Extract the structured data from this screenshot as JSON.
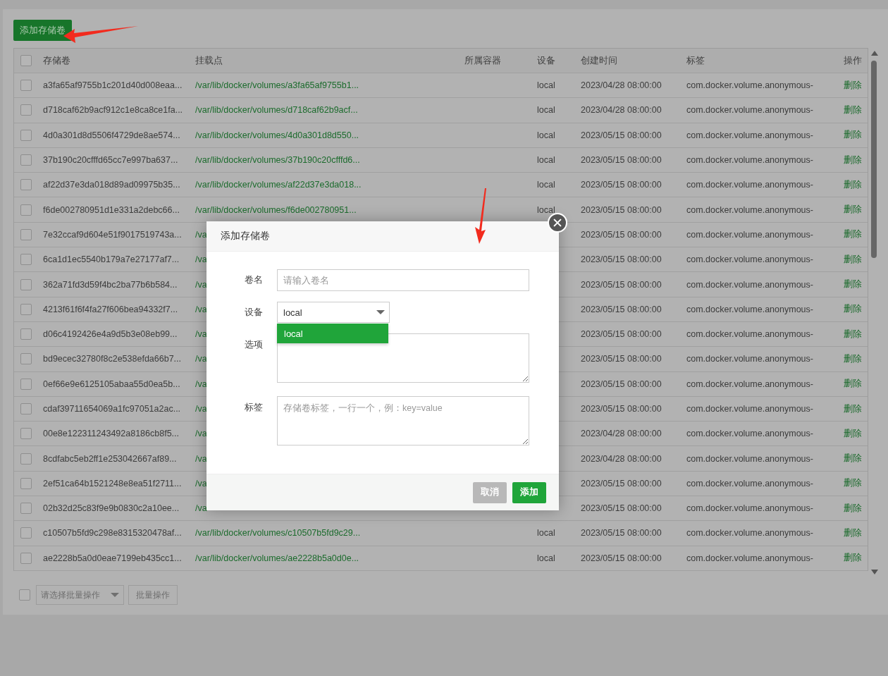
{
  "add_button": {
    "label": "添加存储卷"
  },
  "table": {
    "all_checked": false,
    "columns": [
      "存储卷",
      "挂载点",
      "所属容器",
      "设备",
      "创建时间",
      "标签",
      "操作"
    ],
    "rows": [
      {
        "selected": false,
        "name": "a3fa65af9755b1c201d40d008eaa...",
        "mount": "/var/lib/docker/volumes/a3fa65af9755b1...",
        "device": "local",
        "created": "2023/04/28 08:00:00",
        "label": "com.docker.volume.anonymous-",
        "action": "删除"
      },
      {
        "selected": false,
        "name": "d718caf62b9acf912c1e8ca8ce1fa...",
        "mount": "/var/lib/docker/volumes/d718caf62b9acf...",
        "device": "local",
        "created": "2023/04/28 08:00:00",
        "label": "com.docker.volume.anonymous-",
        "action": "删除"
      },
      {
        "selected": false,
        "name": "4d0a301d8d5506f4729de8ae574...",
        "mount": "/var/lib/docker/volumes/4d0a301d8d550...",
        "device": "local",
        "created": "2023/05/15 08:00:00",
        "label": "com.docker.volume.anonymous-",
        "action": "删除"
      },
      {
        "selected": false,
        "name": "37b190c20cfffd65cc7e997ba637...",
        "mount": "/var/lib/docker/volumes/37b190c20cfffd6...",
        "device": "local",
        "created": "2023/05/15 08:00:00",
        "label": "com.docker.volume.anonymous-",
        "action": "删除"
      },
      {
        "selected": false,
        "name": "af22d37e3da018d89ad09975b35...",
        "mount": "/var/lib/docker/volumes/af22d37e3da018...",
        "device": "local",
        "created": "2023/05/15 08:00:00",
        "label": "com.docker.volume.anonymous-",
        "action": "删除"
      },
      {
        "selected": false,
        "name": "f6de002780951d1e331a2debc66...",
        "mount": "/var/lib/docker/volumes/f6de002780951...",
        "device": "local",
        "created": "2023/05/15 08:00:00",
        "label": "com.docker.volume.anonymous-",
        "action": "删除"
      },
      {
        "selected": false,
        "name": "7e32ccaf9d604e51f9017519743a...",
        "mount": "/va",
        "created": "2023/05/15 08:00:00",
        "label": "com.docker.volume.anonymous-",
        "action": "删除"
      },
      {
        "selected": false,
        "name": "6ca1d1ec5540b179a7e27177af7...",
        "mount": "/va",
        "created": "2023/05/15 08:00:00",
        "label": "com.docker.volume.anonymous-",
        "action": "删除"
      },
      {
        "selected": false,
        "name": "362a71fd3d59f4bc2ba77b6b584...",
        "mount": "/va",
        "created": "2023/05/15 08:00:00",
        "label": "com.docker.volume.anonymous-",
        "action": "删除"
      },
      {
        "selected": false,
        "name": "4213f61f6f4fa27f606bea94332f7...",
        "mount": "/va",
        "created": "2023/05/15 08:00:00",
        "label": "com.docker.volume.anonymous-",
        "action": "删除"
      },
      {
        "selected": false,
        "name": "d06c4192426e4a9d5b3e08eb99...",
        "mount": "/va",
        "created": "2023/05/15 08:00:00",
        "label": "com.docker.volume.anonymous-",
        "action": "删除"
      },
      {
        "selected": false,
        "name": "bd9ecec32780f8c2e538efda66b7...",
        "mount": "/va",
        "created": "2023/05/15 08:00:00",
        "label": "com.docker.volume.anonymous-",
        "action": "删除"
      },
      {
        "selected": false,
        "name": "0ef66e9e6125105abaa55d0ea5b...",
        "mount": "/va",
        "created": "2023/05/15 08:00:00",
        "label": "com.docker.volume.anonymous-",
        "action": "删除"
      },
      {
        "selected": false,
        "name": "cdaf39711654069a1fc97051a2ac...",
        "mount": "/va",
        "created": "2023/05/15 08:00:00",
        "label": "com.docker.volume.anonymous-",
        "action": "删除"
      },
      {
        "selected": false,
        "name": "00e8e122311243492a8186cb8f5...",
        "mount": "/va",
        "created": "2023/04/28 08:00:00",
        "label": "com.docker.volume.anonymous-",
        "action": "删除"
      },
      {
        "selected": false,
        "name": "8cdfabc5eb2ff1e253042667af89...",
        "mount": "/va",
        "created": "2023/04/28 08:00:00",
        "label": "com.docker.volume.anonymous-",
        "action": "删除"
      },
      {
        "selected": false,
        "name": "2ef51ca64b1521248e8ea51f2711...",
        "mount": "/va",
        "created": "2023/05/15 08:00:00",
        "label": "com.docker.volume.anonymous-",
        "action": "删除"
      },
      {
        "selected": false,
        "name": "02b32d25c83f9e9b0830c2a10ee...",
        "mount": "/va",
        "created": "2023/05/15 08:00:00",
        "label": "com.docker.volume.anonymous-",
        "action": "删除"
      },
      {
        "selected": false,
        "name": "c10507b5fd9c298e8315320478af...",
        "mount": "/var/lib/docker/volumes/c10507b5fd9c29...",
        "device": "local",
        "created": "2023/05/15 08:00:00",
        "label": "com.docker.volume.anonymous-",
        "action": "删除"
      },
      {
        "selected": false,
        "name": "ae2228b5a0d0eae7199eb435cc1...",
        "mount": "/var/lib/docker/volumes/ae2228b5a0d0e...",
        "device": "local",
        "created": "2023/05/15 08:00:00",
        "label": "com.docker.volume.anonymous-",
        "action": "删除"
      }
    ]
  },
  "batch": {
    "all_checked": false,
    "placeholder": "请选择批量操作",
    "button": "批量操作"
  },
  "dialog": {
    "title": "添加存储卷",
    "fields": [
      {
        "kind": "input",
        "label": "卷名",
        "placeholder": "请输入卷名"
      },
      {
        "kind": "select",
        "label": "设备",
        "value": "local",
        "options": [
          {
            "label": "local",
            "selected": true
          }
        ]
      },
      {
        "kind": "textarea",
        "label": "选项"
      },
      {
        "kind": "textarea",
        "label": "标签",
        "placeholder": "存储卷标签，一行一个，例：key=value"
      }
    ],
    "buttons": [
      {
        "kind": "cancel",
        "label": "取消"
      },
      {
        "kind": "primary",
        "label": "添加"
      }
    ]
  }
}
